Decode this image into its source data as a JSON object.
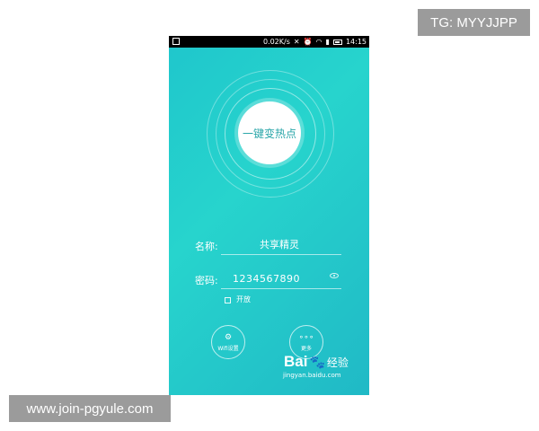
{
  "overlay": {
    "top_right_text": "TG: MYYJJPP",
    "bottom_left_text": "www.join-pgyule.com"
  },
  "statusbar": {
    "speed": "0.02K/s",
    "time": "14:15",
    "icons": [
      "image-icon",
      "mute-icon",
      "alarm-icon",
      "wifi-icon",
      "signal-icon",
      "battery-icon"
    ]
  },
  "hotspot": {
    "button_label": "一键变热点",
    "name_label": "名称:",
    "name_value": "共享精灵",
    "password_label": "密码:",
    "password_value": "1234567890",
    "open_label": "开放",
    "wifi_settings_label": "Wifi设置",
    "more_label": "更多"
  },
  "watermark": {
    "logo_text_1": "Bai",
    "logo_text_2": "经验",
    "url": "jingyan.baidu.com"
  },
  "colors": {
    "background_start": "#1fc6cc",
    "background_end": "#20b9c6",
    "accent": "#2aa6a9"
  }
}
